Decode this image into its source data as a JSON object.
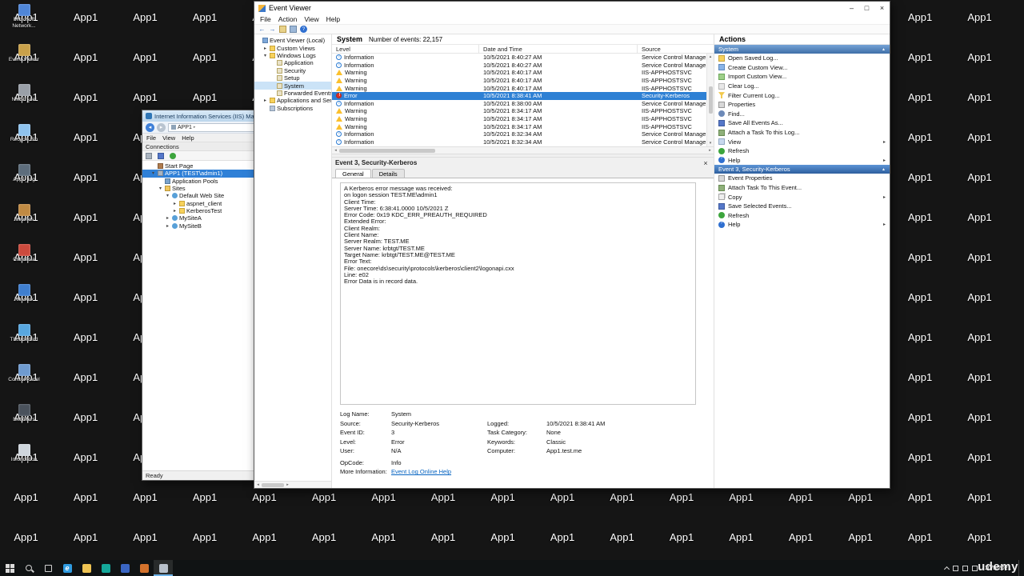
{
  "icons": {
    "left": "◂",
    "right": "▸",
    "up": "▴",
    "down": "▾"
  },
  "watermark": "udemy",
  "desktop": {
    "shortcut_label": "App1",
    "grid": {
      "cols": 17,
      "rows": 14
    },
    "named_icons": [
      {
        "label": "Microsoft Network...",
        "name": "microsoft-network-icon",
        "color": "#4f86d8"
      },
      {
        "label": "Event Viewer",
        "name": "event-viewer-shortcut-icon",
        "color": "#c9a14a"
      },
      {
        "label": "NMSE_del",
        "name": "nmse-del-icon",
        "color": "#9aa0a8"
      },
      {
        "label": "Recycle Bin",
        "name": "recycle-bin-icon",
        "color": "#8fc3ee"
      },
      {
        "label": "App1_log",
        "name": "app1-log-icon",
        "color": "#5d6d7c"
      },
      {
        "label": "favorites",
        "name": "favorites-icon",
        "color": "#c08a43"
      },
      {
        "label": "Camtasia",
        "name": "camtasia-icon",
        "color": "#cc4a3d"
      },
      {
        "label": "Network",
        "name": "network-shortcut-icon",
        "color": "#3f7fd0"
      },
      {
        "label": "Thunderbird",
        "name": "thunderbird-icon",
        "color": "#58a7e0"
      },
      {
        "label": "Control Panel",
        "name": "control-panel-icon",
        "color": "#6f9bd0"
      },
      {
        "label": "Net filters",
        "name": "net-filters-icon",
        "color": "#4a525c"
      },
      {
        "label": "Information",
        "name": "information-icon",
        "color": "#cfd6dd"
      }
    ]
  },
  "ev": {
    "title": "Event Viewer",
    "window_controls": {
      "minimize": "–",
      "maximize": "□",
      "close": "×"
    },
    "menus": [
      "File",
      "Action",
      "View",
      "Help"
    ],
    "toolbar_icons": [
      {
        "name": "back-icon",
        "glyph": "←"
      },
      {
        "name": "forward-icon",
        "glyph": "→"
      },
      {
        "name": "show-console-tree-icon"
      },
      {
        "name": "properties-icon"
      },
      {
        "name": "help-icon",
        "glyph": "?"
      }
    ],
    "tree": [
      {
        "label": "Event Viewer (Local)",
        "indent": 0,
        "glyph": "",
        "icon": "i-evroot",
        "name": "tree-item-event-viewer-local"
      },
      {
        "label": "Custom Views",
        "indent": 1,
        "glyph": "▸",
        "icon": "i-folder",
        "name": "tree-item-custom-views"
      },
      {
        "label": "Windows Logs",
        "indent": 1,
        "glyph": "▾",
        "icon": "i-folder",
        "name": "tree-item-windows-logs"
      },
      {
        "label": "Application",
        "indent": 2,
        "glyph": "",
        "icon": "i-log",
        "name": "tree-item-application"
      },
      {
        "label": "Security",
        "indent": 2,
        "glyph": "",
        "icon": "i-log",
        "name": "tree-item-security"
      },
      {
        "label": "Setup",
        "indent": 2,
        "glyph": "",
        "icon": "i-log",
        "name": "tree-item-setup"
      },
      {
        "label": "System",
        "indent": 2,
        "glyph": "",
        "icon": "i-log",
        "selected": true,
        "name": "tree-item-system"
      },
      {
        "label": "Forwarded Events",
        "indent": 2,
        "glyph": "",
        "icon": "i-log",
        "name": "tree-item-forwarded-events"
      },
      {
        "label": "Applications and Services Logs",
        "indent": 1,
        "glyph": "▸",
        "icon": "i-folder",
        "name": "tree-item-applications-services-logs"
      },
      {
        "label": "Subscriptions",
        "indent": 1,
        "glyph": "",
        "icon": "i-sub",
        "name": "tree-item-subscriptions"
      }
    ],
    "list": {
      "log_name": "System",
      "summary": "Number of events: 22,157",
      "columns": [
        "Level",
        "Date and Time",
        "Source"
      ],
      "rows": [
        {
          "level": "Information",
          "datetime": "10/5/2021 8:40:27 AM",
          "source": "Service Control Manager"
        },
        {
          "level": "Information",
          "datetime": "10/5/2021 8:40:27 AM",
          "source": "Service Control Manager"
        },
        {
          "level": "Warning",
          "datetime": "10/5/2021 8:40:17 AM",
          "source": "IIS-APPHOSTSVC"
        },
        {
          "level": "Warning",
          "datetime": "10/5/2021 8:40:17 AM",
          "source": "IIS-APPHOSTSVC"
        },
        {
          "level": "Warning",
          "datetime": "10/5/2021 8:40:17 AM",
          "source": "IIS-APPHOSTSVC"
        },
        {
          "level": "Error",
          "datetime": "10/5/2021 8:38:41 AM",
          "source": "Security-Kerberos",
          "selected": true
        },
        {
          "level": "Information",
          "datetime": "10/5/2021 8:38:00 AM",
          "source": "Service Control Manager"
        },
        {
          "level": "Warning",
          "datetime": "10/5/2021 8:34:17 AM",
          "source": "IIS-APPHOSTSVC"
        },
        {
          "level": "Warning",
          "datetime": "10/5/2021 8:34:17 AM",
          "source": "IIS-APPHOSTSVC"
        },
        {
          "level": "Warning",
          "datetime": "10/5/2021 8:34:17 AM",
          "source": "IIS-APPHOSTSVC"
        },
        {
          "level": "Information",
          "datetime": "10/5/2021 8:32:34 AM",
          "source": "Service Control Manager"
        },
        {
          "level": "Information",
          "datetime": "10/5/2021 8:32:34 AM",
          "source": "Service Control Manager"
        }
      ]
    },
    "detail": {
      "title": "Event 3, Security-Kerberos",
      "close_glyph": "×",
      "tabs": [
        "General",
        "Details"
      ],
      "body_lines": [
        "A Kerberos error message was received:",
        "on logon session TEST.ME\\admin1",
        "Client Time:",
        "Server Time: 6:38:41.0000 10/5/2021 Z",
        "Error Code: 0x19 KDC_ERR_PREAUTH_REQUIRED",
        "Extended Error:",
        "Client Realm:",
        "Client Name:",
        "Server Realm: TEST.ME",
        "Server Name: krbtgt/TEST.ME",
        "Target Name: krbtgt/TEST.ME@TEST.ME",
        "Error Text:",
        "File: onecore\\ds\\security\\protocols\\kerberos\\client2\\logonapi.cxx",
        "Line: e02",
        "Error Data is in record data."
      ],
      "fields": {
        "log_name_label": "Log Name:",
        "log_name": "System",
        "source_label": "Source:",
        "source": "Security-Kerberos",
        "logged_label": "Logged:",
        "logged": "10/5/2021 8:38:41 AM",
        "event_id_label": "Event ID:",
        "event_id": "3",
        "task_category_label": "Task Category:",
        "task_category": "None",
        "level_label": "Level:",
        "level": "Error",
        "keywords_label": "Keywords:",
        "keywords": "Classic",
        "user_label": "User:",
        "user": "N/A",
        "computer_label": "Computer:",
        "computer": "App1.test.me",
        "opcode_label": "OpCode:",
        "opcode": "Info",
        "more_info_label": "More Information:",
        "more_info_link": "Event Log Online Help"
      }
    },
    "actions": {
      "title": "Actions",
      "system_group": {
        "title": "System",
        "collapse_glyph": "▲",
        "items": [
          {
            "label": "Open Saved Log...",
            "icon": "i-folder",
            "arrow": "",
            "name": "action-open-saved-log"
          },
          {
            "label": "Create Custom View...",
            "icon": "i-view",
            "arrow": "",
            "name": "action-create-custom-view"
          },
          {
            "label": "Import Custom View...",
            "icon": "i-import",
            "arrow": "",
            "name": "action-import-custom-view"
          },
          {
            "label": "Clear Log...",
            "icon": "i-clear",
            "arrow": "",
            "name": "action-clear-log"
          },
          {
            "label": "Filter Current Log...",
            "icon": "i-filter",
            "arrow": "",
            "name": "action-filter-current-log"
          },
          {
            "label": "Properties",
            "icon": "i-props",
            "arrow": "",
            "name": "action-properties"
          },
          {
            "label": "Find...",
            "icon": "i-find",
            "arrow": "",
            "name": "action-find"
          },
          {
            "label": "Save All Events As...",
            "icon": "i-save",
            "arrow": "",
            "name": "action-save-all-events-as"
          },
          {
            "label": "Attach a Task To this Log...",
            "icon": "i-task",
            "arrow": "",
            "name": "action-attach-task-to-log"
          },
          {
            "label": "View",
            "icon": "i-viewmenu",
            "arrow": "▸",
            "name": "action-view"
          },
          {
            "label": "Refresh",
            "icon": "i-refresh",
            "arrow": "",
            "name": "action-refresh"
          },
          {
            "label": "Help",
            "icon": "i-help",
            "arrow": "▸",
            "name": "action-help"
          }
        ]
      },
      "event_group": {
        "title": "Event 3, Security-Kerberos",
        "collapse_glyph": "▲",
        "items": [
          {
            "label": "Event Properties",
            "icon": "i-props",
            "arrow": "",
            "name": "action-event-properties"
          },
          {
            "label": "Attach Task To This Event...",
            "icon": "i-task",
            "arrow": "",
            "name": "action-attach-task-to-event"
          },
          {
            "label": "Copy",
            "icon": "i-copy",
            "arrow": "▸",
            "name": "action-copy"
          },
          {
            "label": "Save Selected Events...",
            "icon": "i-save",
            "arrow": "",
            "name": "action-save-selected-events"
          },
          {
            "label": "Refresh",
            "icon": "i-refresh",
            "arrow": "",
            "name": "action-refresh-event"
          },
          {
            "label": "Help",
            "icon": "i-help",
            "arrow": "▸",
            "name": "action-help-event"
          }
        ]
      }
    }
  },
  "iis": {
    "title": "Internet Information Services (IIS) Manager",
    "breadcrumb": "APP1",
    "breadcrumb_arrow": "▸",
    "menus": [
      "File",
      "View",
      "Help"
    ],
    "connections_title": "Connections",
    "tree": [
      {
        "label": "Start Page",
        "indent": 1,
        "glyph": "",
        "icon": "i-home",
        "name": "iis-tree-start-page"
      },
      {
        "label": "APP1 (TEST\\admin1)",
        "indent": 1,
        "glyph": "▾",
        "icon": "i-server",
        "selected": true,
        "name": "iis-tree-app1-server"
      },
      {
        "label": "Application Pools",
        "indent": 2,
        "glyph": "",
        "icon": "i-pools",
        "name": "iis-tree-application-pools"
      },
      {
        "label": "Sites",
        "indent": 2,
        "glyph": "▾",
        "icon": "i-sites",
        "name": "iis-tree-sites"
      },
      {
        "label": "Default Web Site",
        "indent": 3,
        "glyph": "▾",
        "icon": "i-site",
        "name": "iis-tree-default-web-site"
      },
      {
        "label": "aspnet_client",
        "indent": 4,
        "glyph": "▸",
        "icon": "i-folder",
        "name": "iis-tree-aspnet-client"
      },
      {
        "label": "KerberosTest",
        "indent": 4,
        "glyph": "▸",
        "icon": "i-folder",
        "name": "iis-tree-kerberostest"
      },
      {
        "label": "MySiteA",
        "indent": 3,
        "glyph": "▸",
        "icon": "i-site",
        "name": "iis-tree-mysitea"
      },
      {
        "label": "MySiteB",
        "indent": 3,
        "glyph": "▸",
        "icon": "i-site",
        "name": "iis-tree-mysiteb"
      }
    ],
    "status": "Ready"
  },
  "taskbar": {
    "buttons": [
      {
        "name": "start-button"
      },
      {
        "name": "search-button"
      },
      {
        "name": "task-view-button"
      },
      {
        "name": "edge-icon",
        "color": "#2f9be0",
        "glyph": "e"
      },
      {
        "name": "file-explorer-icon",
        "color": "#eec353"
      },
      {
        "name": "store-icon",
        "color": "#14a79a"
      },
      {
        "name": "app-icon-blue",
        "color": "#3a66c4"
      },
      {
        "name": "app-icon-orange",
        "color": "#d3722c"
      },
      {
        "name": "event-viewer-taskbar-icon",
        "color": "#b9c2cc",
        "selected": true
      }
    ],
    "tray_date": "10/5/2021"
  }
}
